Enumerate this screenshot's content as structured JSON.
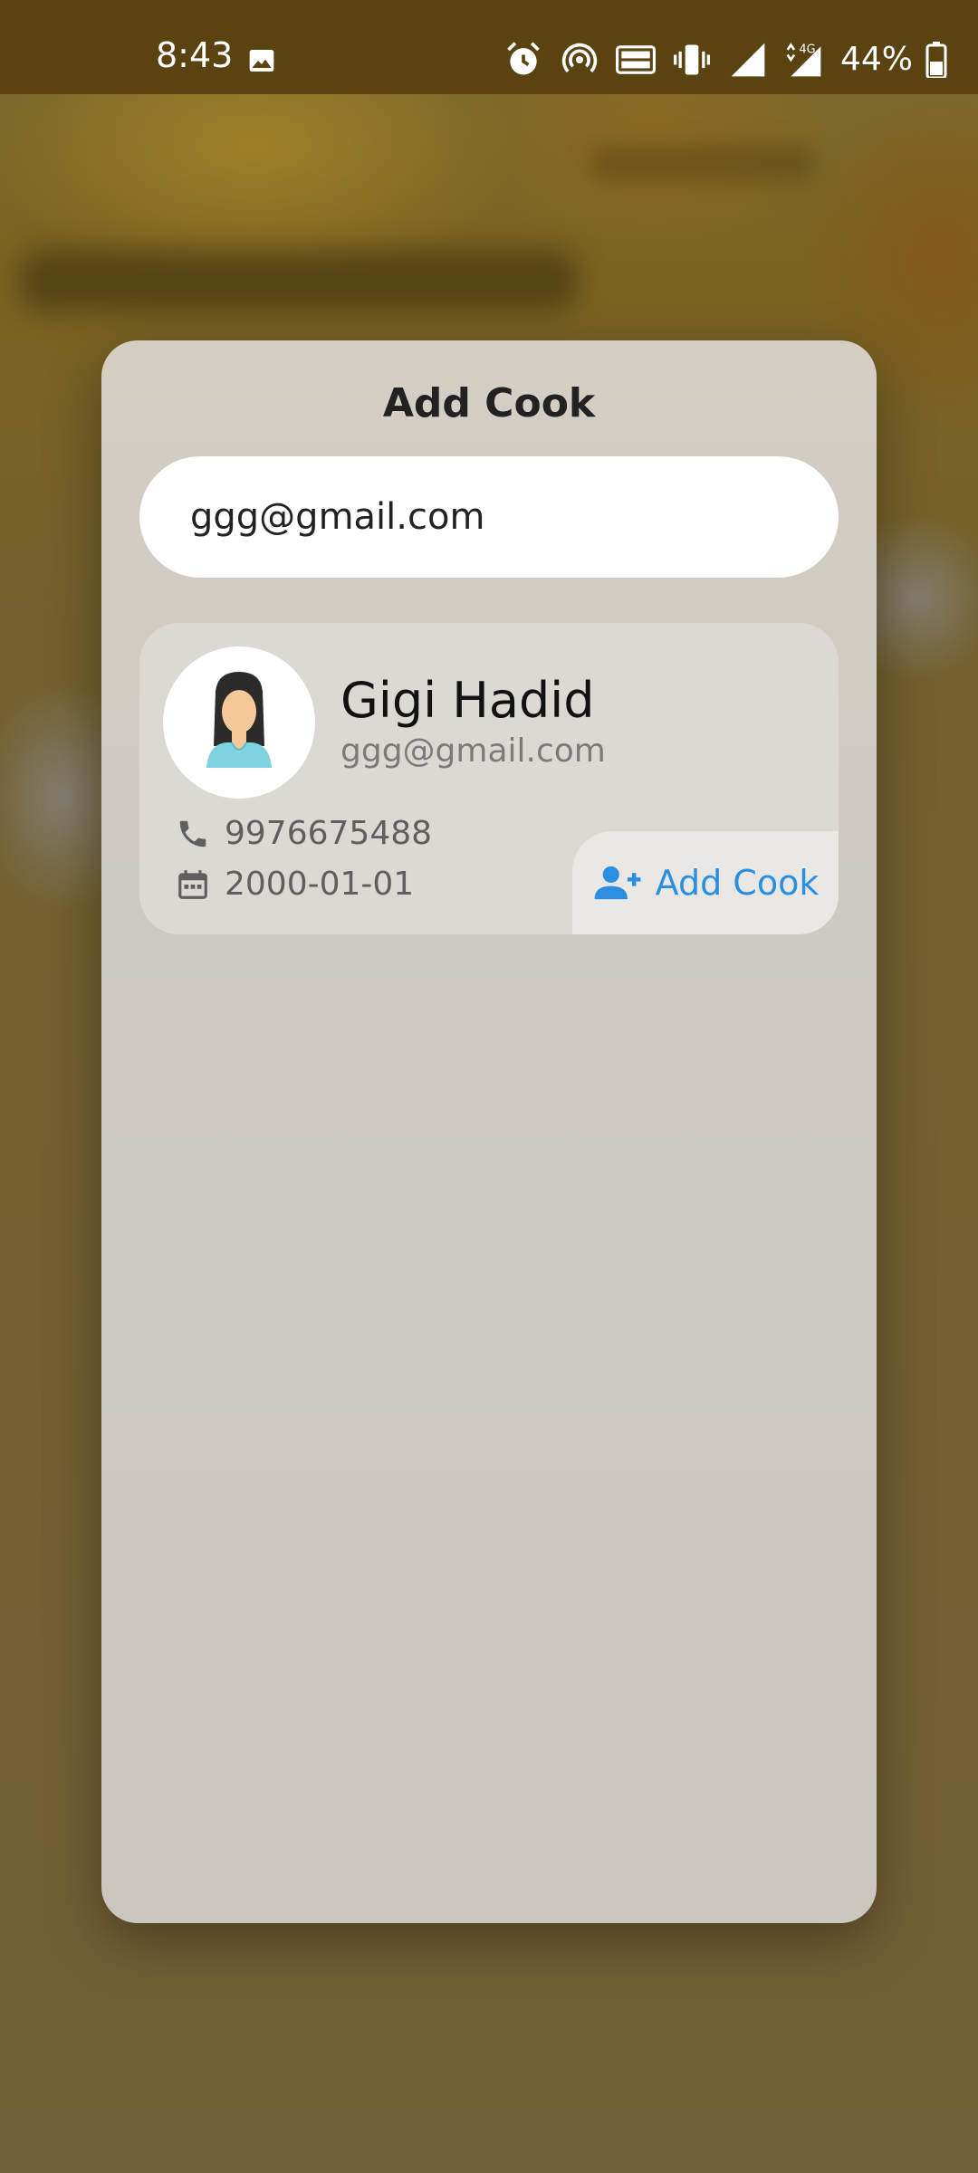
{
  "status_bar": {
    "time": "8:43",
    "battery": "44%",
    "network_label": "4G",
    "icons": [
      "image-icon",
      "alarm-icon",
      "hotspot-icon",
      "volte-icon",
      "vibrate-icon",
      "signal-icon",
      "signal-4g-icon",
      "battery-icon"
    ]
  },
  "dialog": {
    "title": "Add Cook",
    "search_value": "ggg@gmail.com",
    "result": {
      "name": "Gigi Hadid",
      "email": "ggg@gmail.com",
      "phone": "9976675488",
      "dob": "2000-01-01",
      "add_button_label": "Add Cook"
    }
  },
  "colors": {
    "accent": "#2a8fe0",
    "dialog_bg": "#cdc9c3",
    "status_bar_bg": "#5a4310"
  }
}
